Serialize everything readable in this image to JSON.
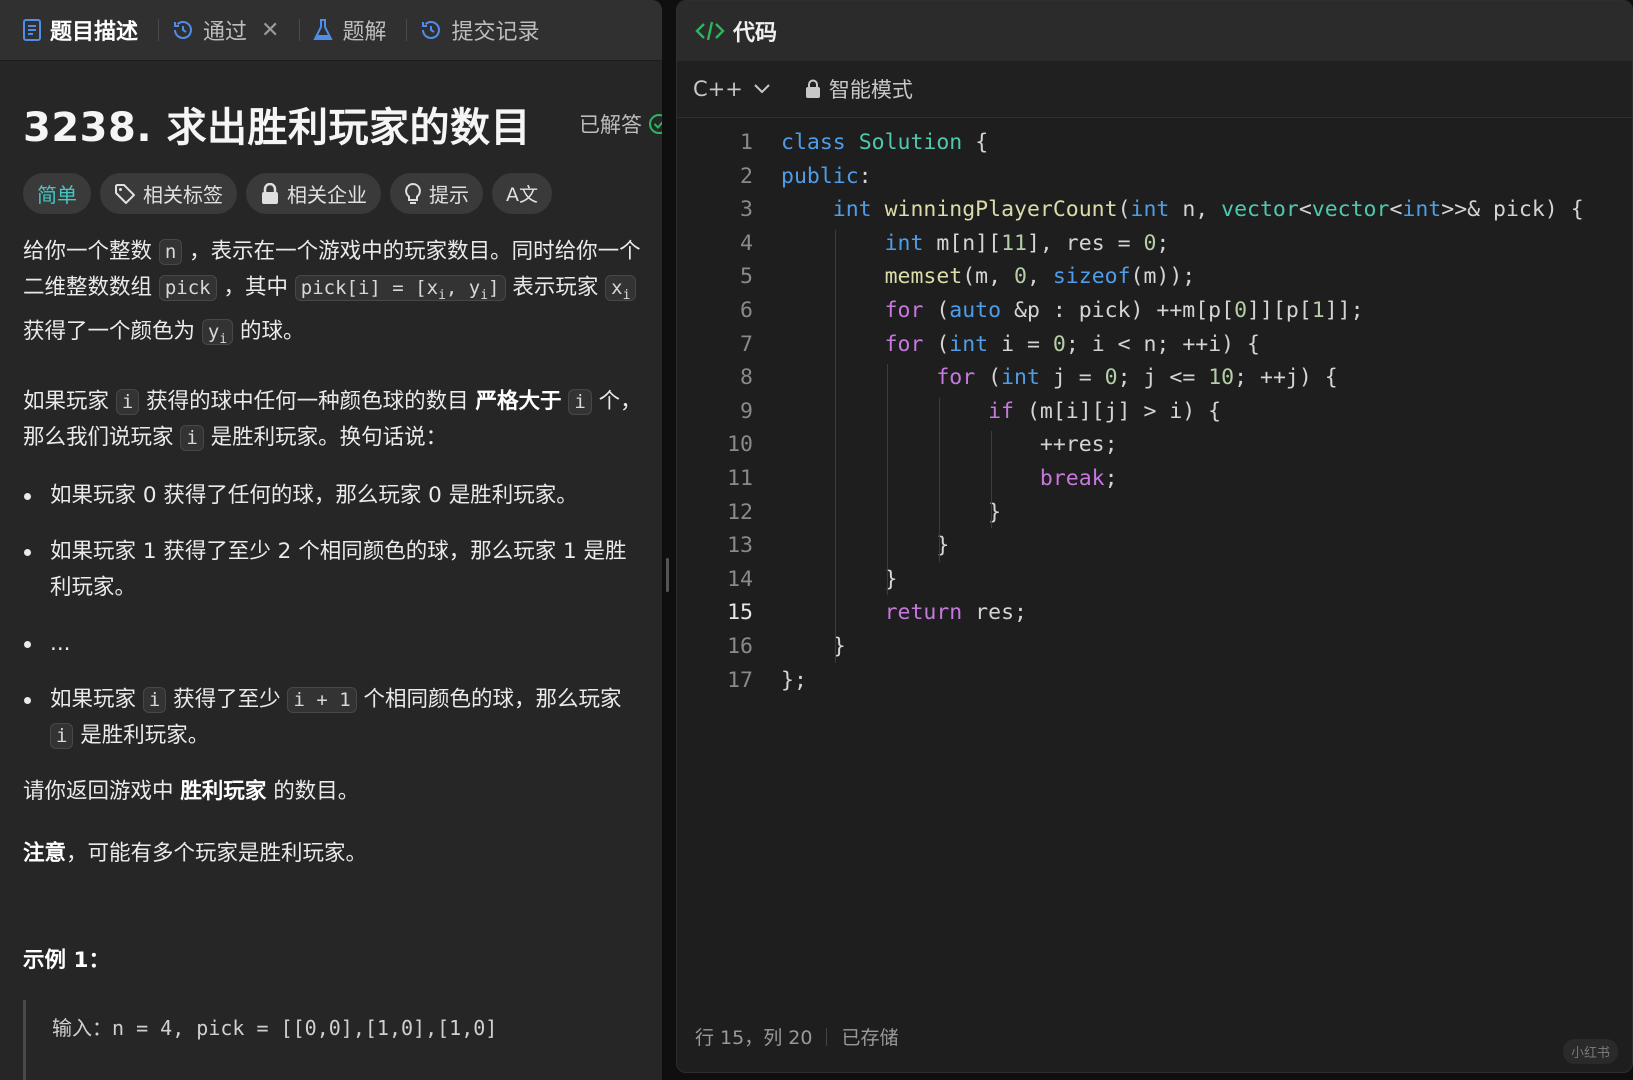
{
  "left_tabs": [
    {
      "label": "题目描述",
      "icon": "document-icon"
    },
    {
      "label": "通过",
      "icon": "history-icon"
    },
    {
      "label": "题解",
      "icon": "flask-icon"
    },
    {
      "label": "提交记录",
      "icon": "history-icon"
    }
  ],
  "problem": {
    "title": "3238. 求出胜利玩家的数目",
    "solved_label": "已解答",
    "chips": {
      "difficulty": "简单",
      "tags": "相关标签",
      "companies": "相关企业",
      "hint": "提示",
      "translate": "A文"
    },
    "p1": {
      "t1": "给你一个整数 ",
      "c1": "n",
      "t2": " ，表示在一个游戏中的玩家数目。同时给你一个二维整数数组 ",
      "c2": "pick",
      "t3": " ，其中 ",
      "c3a": "pick[i] = [x",
      "c3sub1": "i",
      "c3b": ", y",
      "c3sub2": "i",
      "c3c": "]",
      "t4": " 表示玩家 ",
      "c4": "x",
      "c4sub": "i",
      "t5": " 获得了一个颜色为 ",
      "c5": "y",
      "c5sub": "i",
      "t6": " 的球。"
    },
    "p2": {
      "t1": "如果玩家 ",
      "c1": "i",
      "t2": " 获得的球中任何一种颜色球的数目 ",
      "b1": "严格大于",
      "t3": " ",
      "c2": "i",
      "t4": " 个，那么我们说玩家 ",
      "c3": "i",
      "t5": " 是胜利玩家。换句话说："
    },
    "bullets": {
      "b1": "如果玩家 0 获得了任何的球，那么玩家 0 是胜利玩家。",
      "b2": "如果玩家 1 获得了至少 2 个相同颜色的球，那么玩家 1 是胜利玩家。",
      "b3": "...",
      "b4_t1": "如果玩家 ",
      "b4_c1": "i",
      "b4_t2": " 获得了至少 ",
      "b4_c2": "i + 1",
      "b4_t3": " 个相同颜色的球，那么玩家 ",
      "b4_c3": "i",
      "b4_t4": " 是胜利玩家。"
    },
    "p3": {
      "t1": "请你返回游戏中 ",
      "b1": "胜利玩家",
      "t2": " 的数目。"
    },
    "p4": {
      "b1": "注意",
      "t1": "，可能有多个玩家是胜利玩家。"
    },
    "example_title": "示例 1：",
    "example_input": "输入：n = 4, pick = [[0,0],[1,0],[1,0]"
  },
  "code_panel": {
    "header": "代码",
    "language": "C++",
    "mode": "智能模式",
    "current_line": 15,
    "lines": [
      "class Solution {",
      "public:",
      "    int winningPlayerCount(int n, vector<vector<int>>& pick) {",
      "        int m[n][11], res = 0;",
      "        memset(m, 0, sizeof(m));",
      "        for (auto &p : pick) ++m[p[0]][p[1]];",
      "        for (int i = 0; i < n; ++i) {",
      "            for (int j = 0; j <= 10; ++j) {",
      "                if (m[i][j] > i) {",
      "                    ++res;",
      "                    break;",
      "                }",
      "            }",
      "        }",
      "        return res;",
      "    }",
      "};"
    ],
    "status_pos": "行 15，列 20",
    "status_saved": "已存储"
  },
  "watermark": "小红书"
}
